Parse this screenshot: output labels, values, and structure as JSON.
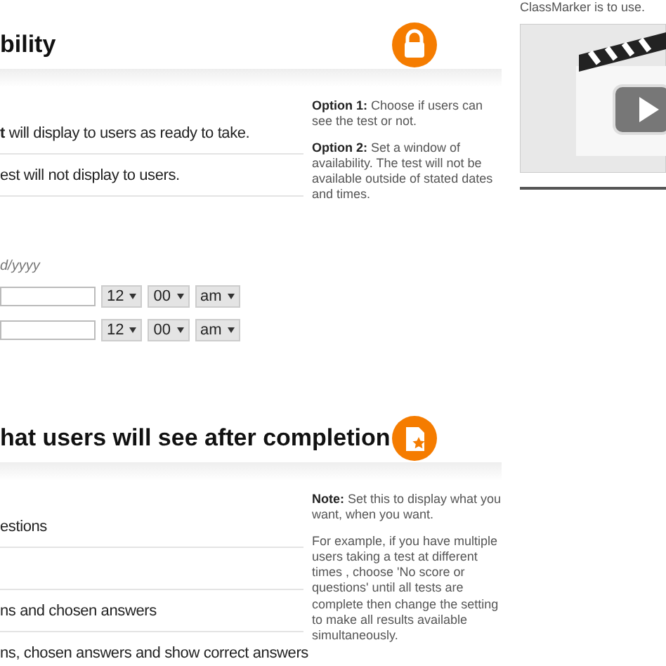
{
  "sections": [
    {
      "title": "bility",
      "options": [
        {
          "kind": "text",
          "label": "**t** will display to users as ready to take."
        },
        {
          "kind": "text",
          "label": "est will not display to users."
        }
      ],
      "date_hint": "d/yyyy",
      "time_rows": [
        {
          "hour": "12",
          "minute": "00",
          "period": "am"
        },
        {
          "hour": "12",
          "minute": "00",
          "period": "am"
        }
      ],
      "help": [
        "**Option 1:** Choose if users can see the test or not.",
        "**Option 2:** Set a window of availability. The test will not be available outside of stated dates and times."
      ]
    },
    {
      "title": "hat users will see after completion",
      "options": [
        {
          "kind": "text",
          "label": "estions"
        },
        {
          "kind": "blank"
        },
        {
          "kind": "text",
          "label": "ns and chosen answers"
        },
        {
          "kind": "text",
          "label": "ns, chosen answers and show correct answers"
        }
      ],
      "help": [
        "**Note:** Set this to display what you want, when you want.",
        "For example, if you have multiple users taking a test at different times , choose 'No score or questions' until all tests are complete then change the setting to make all results available simultaneously."
      ]
    }
  ],
  "sidebar": {
    "text": "ClassMarker is to use."
  }
}
